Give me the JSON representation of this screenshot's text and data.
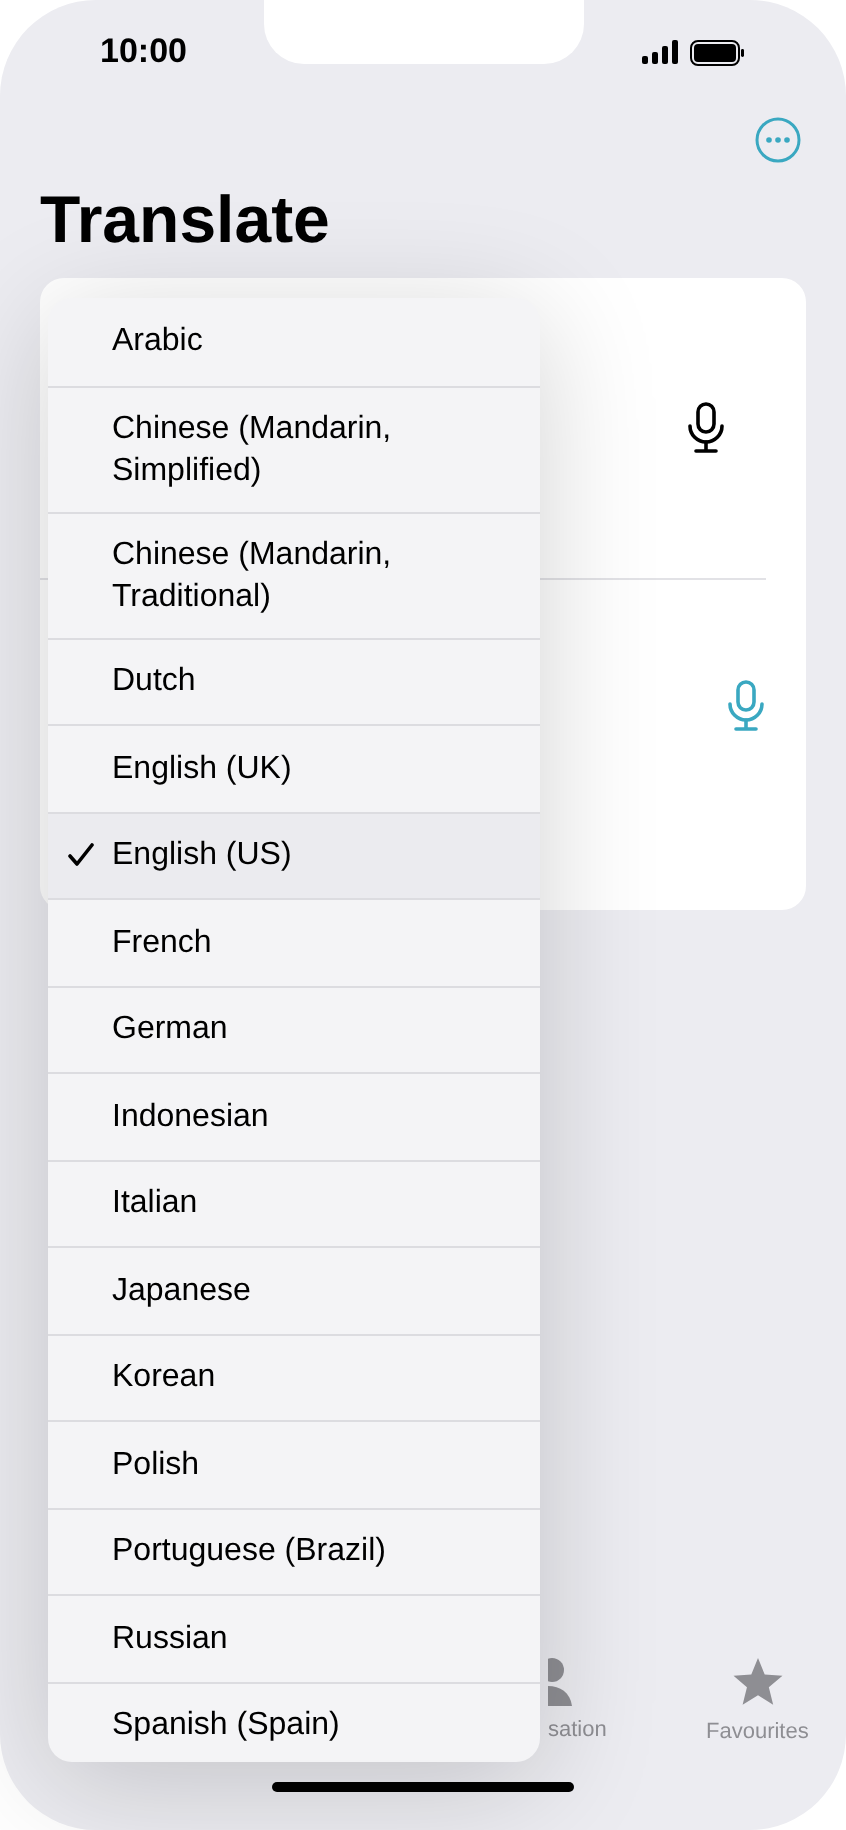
{
  "status_bar": {
    "time": "10:00"
  },
  "title": "Translate",
  "menu": {
    "items": [
      {
        "label": "Arabic",
        "selected": false
      },
      {
        "label": "Chinese (Mandarin, Simplified)",
        "selected": false
      },
      {
        "label": "Chinese (Mandarin, Traditional)",
        "selected": false
      },
      {
        "label": "Dutch",
        "selected": false
      },
      {
        "label": "English (UK)",
        "selected": false
      },
      {
        "label": "English (US)",
        "selected": true
      },
      {
        "label": "French",
        "selected": false
      },
      {
        "label": "German",
        "selected": false
      },
      {
        "label": "Indonesian",
        "selected": false
      },
      {
        "label": "Italian",
        "selected": false
      },
      {
        "label": "Japanese",
        "selected": false
      },
      {
        "label": "Korean",
        "selected": false
      },
      {
        "label": "Polish",
        "selected": false
      },
      {
        "label": "Portuguese (Brazil)",
        "selected": false
      },
      {
        "label": "Russian",
        "selected": false
      },
      {
        "label": "Spanish (Spain)",
        "selected": false
      }
    ]
  },
  "tab_bar": {
    "items": [
      {
        "label": "sation",
        "kind": "person"
      },
      {
        "label": "Favourites",
        "kind": "star"
      }
    ]
  }
}
